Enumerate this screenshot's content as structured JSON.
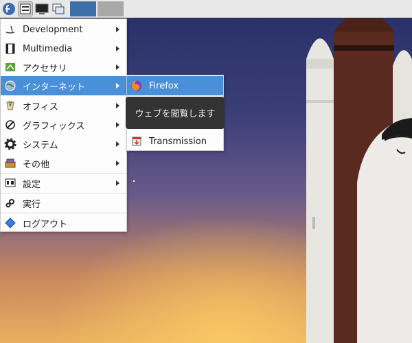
{
  "panel": {
    "buttons": [
      "fedora-logo-icon",
      "menu-icon",
      "show-desktop-icon",
      "window-list-icon"
    ],
    "workspaces": [
      "workspace-1",
      "workspace-2"
    ]
  },
  "menu": {
    "items": [
      {
        "label": "Development",
        "icon": "development-icon",
        "submenu": true
      },
      {
        "label": "Multimedia",
        "icon": "multimedia-icon",
        "submenu": true
      },
      {
        "label": "アクセサリ",
        "icon": "accessories-icon",
        "submenu": true
      },
      {
        "label": "インターネット",
        "icon": "internet-icon",
        "submenu": true
      },
      {
        "label": "オフィス",
        "icon": "office-icon",
        "submenu": true
      },
      {
        "label": "グラフィックス",
        "icon": "graphics-icon",
        "submenu": true
      },
      {
        "label": "システム",
        "icon": "system-icon",
        "submenu": true
      },
      {
        "label": "その他",
        "icon": "other-icon",
        "submenu": true
      },
      {
        "label": "設定",
        "icon": "settings-icon",
        "submenu": true
      },
      {
        "label": "実行",
        "icon": "run-icon",
        "submenu": false
      },
      {
        "label": "ログアウト",
        "icon": "logout-icon",
        "submenu": false
      }
    ],
    "highlighted": "インターネット"
  },
  "submenu": {
    "items": [
      {
        "label": "Firefox",
        "icon": "firefox-icon"
      },
      {
        "label": "Transmission",
        "icon": "transmission-icon"
      }
    ]
  },
  "tooltip": {
    "text": "ウェブを閲覧します"
  },
  "colors": {
    "highlight": "#4a90d9",
    "panel": "#e8e8e8",
    "workspace_active": "#3d6fa8"
  }
}
